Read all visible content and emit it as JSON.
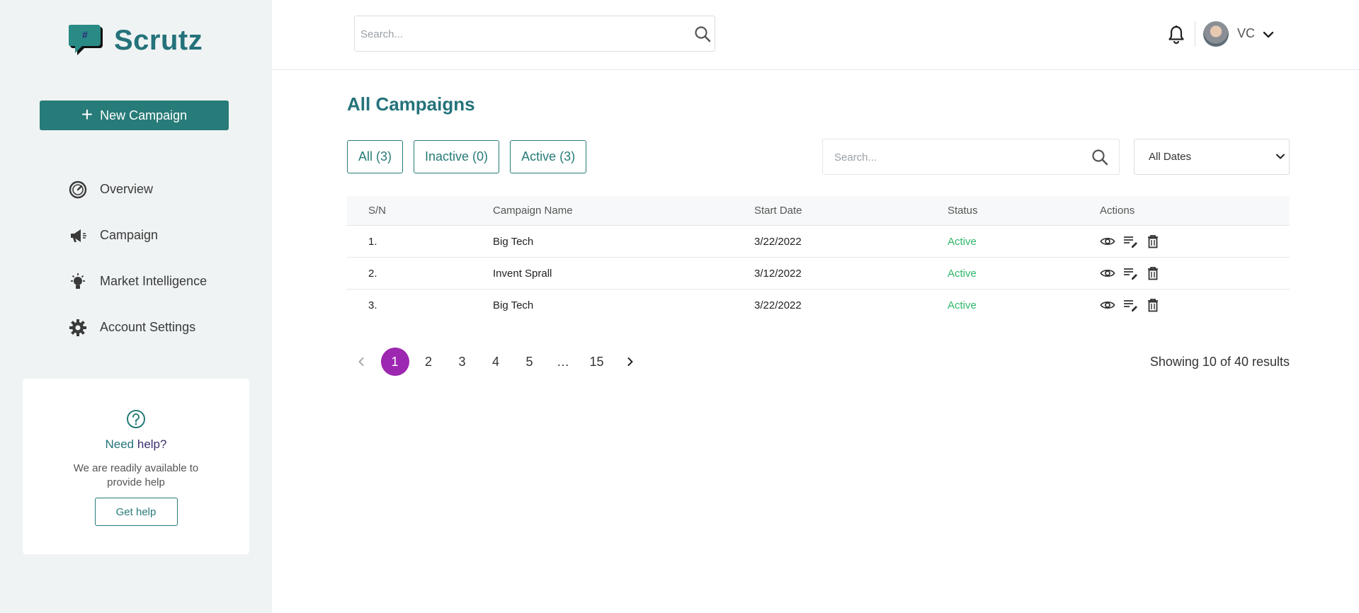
{
  "app": {
    "name": "Scrutz"
  },
  "sidebar": {
    "new_campaign_label": "New Campaign",
    "items": [
      {
        "label": "Overview",
        "icon": "speedometer-icon"
      },
      {
        "label": "Campaign",
        "icon": "megaphone-icon"
      },
      {
        "label": "Market Intelligence",
        "icon": "lightbulb-icon"
      },
      {
        "label": "Account Settings",
        "icon": "gear-icon"
      }
    ],
    "help": {
      "title_part1": "Need ",
      "title_part2": "help?",
      "description": "We are readily available to provide help",
      "button_label": "Get help"
    }
  },
  "header": {
    "search_placeholder": "Search...",
    "user_initials": "VC"
  },
  "main": {
    "title": "All Campaigns",
    "tabs": [
      {
        "label": "All (3)"
      },
      {
        "label": "Inactive (0)"
      },
      {
        "label": "Active (3)"
      }
    ],
    "search_placeholder": "Search...",
    "date_filter": "All Dates",
    "table": {
      "columns": [
        "S/N",
        "Campaign Name",
        "Start Date",
        "Status",
        "Actions"
      ],
      "rows": [
        {
          "sn": "1.",
          "name": "Big Tech",
          "start": "3/22/2022",
          "status": "Active"
        },
        {
          "sn": "2.",
          "name": "Invent Sprall",
          "start": "3/12/2022",
          "status": "Active"
        },
        {
          "sn": "3.",
          "name": "Big Tech",
          "start": "3/22/2022",
          "status": "Active"
        }
      ]
    },
    "pagination": {
      "pages": [
        "1",
        "2",
        "3",
        "4",
        "5",
        "…",
        "15"
      ],
      "current": "1",
      "summary": "Showing 10 of 40 results"
    }
  },
  "colors": {
    "brand_teal": "#277b78",
    "active_green": "#2fb66a",
    "pagination_current": "#9c27b0"
  }
}
